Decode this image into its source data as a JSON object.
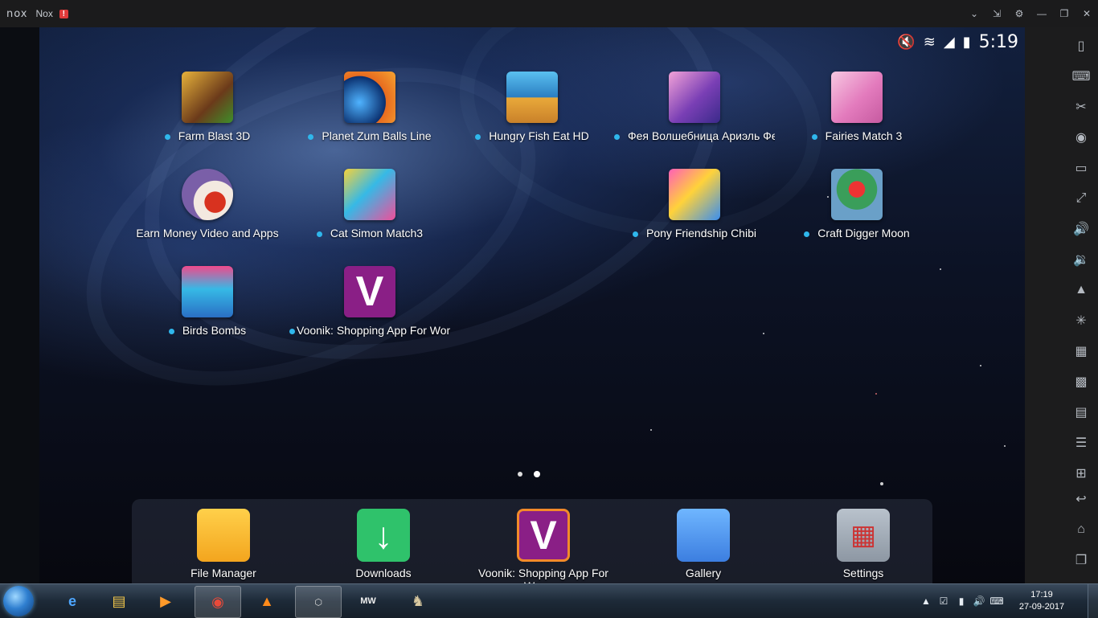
{
  "titlebar": {
    "logo": "nox",
    "app_name": "Nox",
    "warning": "!",
    "controls": [
      {
        "name": "collapse-icon",
        "glyph": "⌄"
      },
      {
        "name": "pin-icon",
        "glyph": "⇲"
      },
      {
        "name": "settings-icon",
        "glyph": "⚙"
      },
      {
        "name": "minimize-icon",
        "glyph": "—"
      },
      {
        "name": "restore-icon",
        "glyph": "❐"
      },
      {
        "name": "close-icon",
        "glyph": "✕"
      }
    ]
  },
  "statusbar": {
    "time": "5:19",
    "icons": [
      "mute-icon",
      "wifi-icon",
      "signal-icon",
      "battery-icon"
    ]
  },
  "apps": [
    {
      "label": "Farm Blast 3D",
      "new": true
    },
    {
      "label": "Planet Zum Balls Line",
      "new": true
    },
    {
      "label": "Hungry Fish Eat HD",
      "new": true
    },
    {
      "label": "Фея Волшебница Ариэль Фея Б",
      "new": true
    },
    {
      "label": "Fairies Match 3",
      "new": true
    },
    {
      "label": "Earn Money Video and Apps",
      "new": false
    },
    {
      "label": "Cat Simon Match3",
      "new": true
    },
    {
      "label": "Pony Friendship Chibi",
      "new": true
    },
    {
      "label": "Craft Digger Moon",
      "new": true
    },
    {
      "label": "Birds Bombs",
      "new": true
    },
    {
      "label": "Voonik: Shopping App For Women",
      "new": true
    }
  ],
  "dock": [
    {
      "label": "File Manager"
    },
    {
      "label": "Downloads"
    },
    {
      "label": "Voonik: Shopping App For Women"
    },
    {
      "label": "Gallery"
    },
    {
      "label": "Settings"
    }
  ],
  "page_indicator": {
    "pages": 2,
    "current": 2
  },
  "toolbar_icons": [
    "shake-icon",
    "keyboard-icon",
    "screenshot-scissors-icon",
    "location-icon",
    "screen-icon",
    "fullscreen-icon",
    "volume-up-icon",
    "volume-down-icon",
    "apk-install-icon",
    "loading-icon",
    "multi-instance-icon",
    "macro-icon",
    "record-icon",
    "menu-icon",
    "add-icon",
    "back-icon",
    "home-icon",
    "recent-apps-icon"
  ],
  "taskbar": {
    "items": [
      "ie-icon",
      "explorer-icon",
      "media-player-icon",
      "chrome-icon",
      "vlc-icon",
      "nox-icon",
      "mw-game-icon",
      "game-icon"
    ],
    "clock_time": "17:19",
    "clock_date": "27-09-2017"
  },
  "colors": {
    "accent_dot": "#2fb7ec",
    "titlebar": "#1b1b1c",
    "toolbar": "#1c1c1d"
  }
}
